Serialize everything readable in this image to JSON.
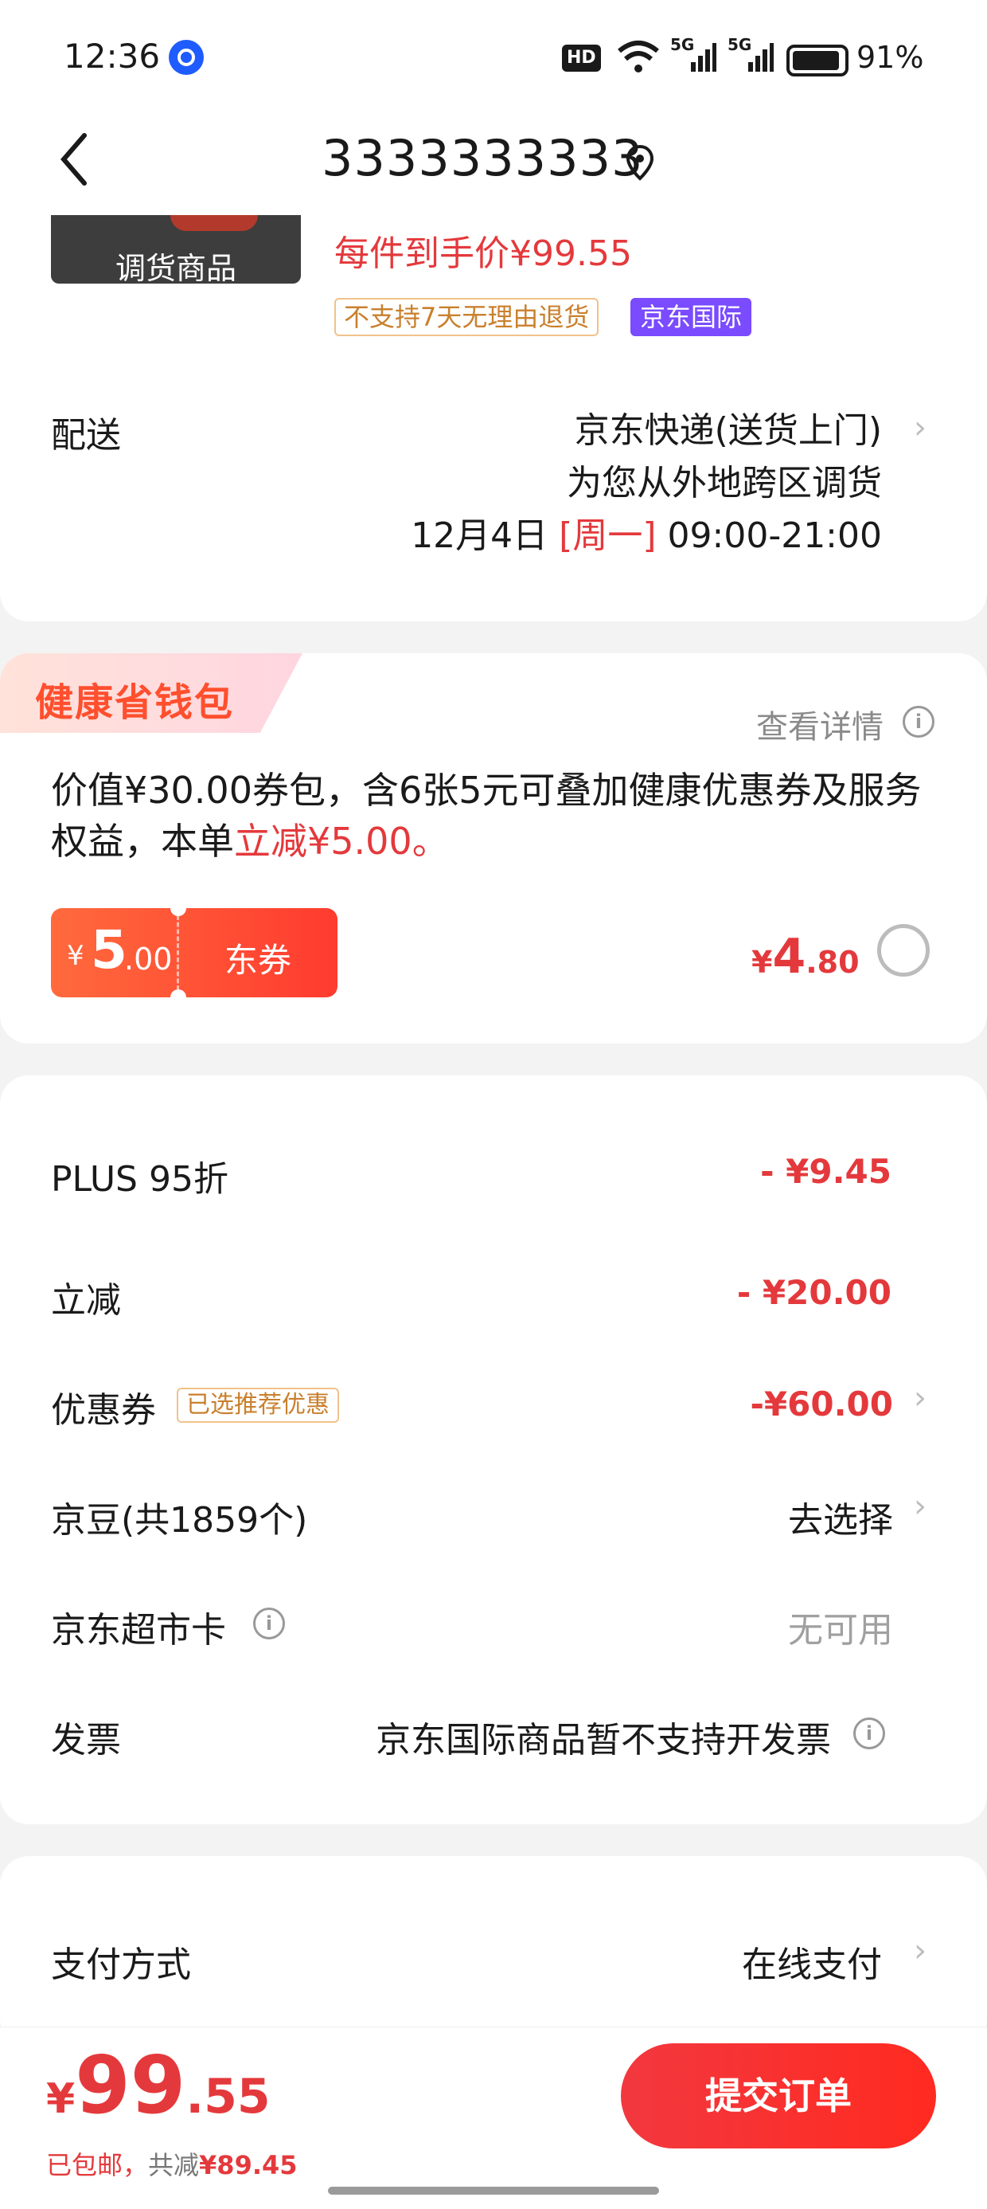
{
  "status_bar": {
    "time": "12:36",
    "battery": "91%",
    "net1": "5G",
    "net2": "5G",
    "hd": "HD"
  },
  "header": {
    "title": "3333333333"
  },
  "product": {
    "image_label": "调货商品",
    "price_text": "每件到手价¥99.55",
    "tag_no_return": "不支持7天无理由退货",
    "tag_intl": "京东国际"
  },
  "delivery": {
    "label": "配送",
    "method": "京东快递(送货上门)",
    "note": "为您从外地跨区调货",
    "date": "12月4日",
    "weekday": "[周一]",
    "time": "09:00-21:00"
  },
  "wallet": {
    "title": "健康省钱包",
    "details": "查看详情",
    "desc_part1": "价值¥30.00券包，含6张5元可叠加健康优惠券及服务权益，本单",
    "desc_highlight": "立减¥5.00。",
    "coupon_symbol": "¥",
    "coupon_int": "5",
    "coupon_dec": ".00",
    "coupon_type": "东券",
    "price_symbol": "¥",
    "price_int": "4",
    "price_dec": ".80"
  },
  "discounts": {
    "plus_label": "PLUS 95折",
    "plus_value": "- ¥9.45",
    "instant_label": "立减",
    "instant_value": "- ¥20.00",
    "coupon_label": "优惠券",
    "coupon_badge": "已选推荐优惠",
    "coupon_value": "-¥60.00",
    "beans_label": "京豆(共1859个)",
    "beans_value": "去选择",
    "card_label": "京东超市卡",
    "card_value": "无可用",
    "invoice_label": "发票",
    "invoice_value": "京东国际商品暂不支持开发票"
  },
  "payment": {
    "label": "支付方式",
    "value": "在线支付"
  },
  "bottom": {
    "currency": "¥",
    "total_int": "99",
    "total_dec": ".55",
    "shipping": "已包邮，",
    "saved_label": "共减",
    "saved_value": "¥89.45",
    "submit": "提交订单"
  },
  "colors": {
    "accent": "#e4393c",
    "brand_purple": "#7a4bff",
    "coupon_orange": "#ff5a3c"
  }
}
